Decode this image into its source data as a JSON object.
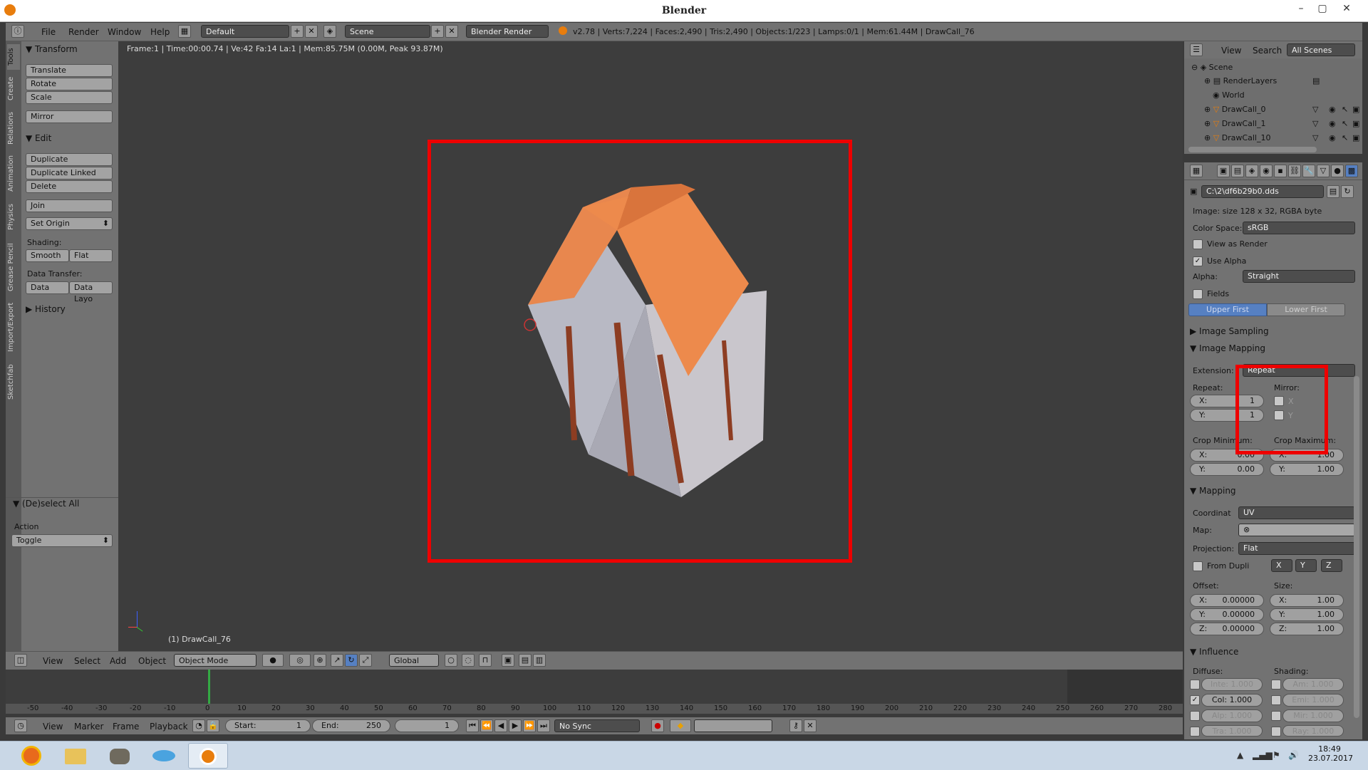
{
  "window": {
    "title": "Blender"
  },
  "infoheader": {
    "menus": [
      "File",
      "Render",
      "Window",
      "Help"
    ],
    "screen_layout": "Default",
    "scene": "Scene",
    "engine": "Blender Render",
    "stats": "v2.78 | Verts:7,224 | Faces:2,490 | Tris:2,490 | Objects:1/223 | Lamps:0/1 | Mem:61.44M | DrawCall_76"
  },
  "left_tabs": [
    "Tools",
    "Create",
    "Relations",
    "Animation",
    "Physics",
    "Grease Pencil",
    "Import/Export",
    "Sketchfab"
  ],
  "toolshelf": {
    "transform": {
      "title": "Transform",
      "buttons": [
        "Translate",
        "Rotate",
        "Scale",
        "Mirror"
      ]
    },
    "edit": {
      "title": "Edit",
      "buttons": [
        "Duplicate",
        "Duplicate Linked",
        "Delete",
        "Join"
      ],
      "set_origin": "Set Origin"
    },
    "shading_label": "Shading:",
    "shading": [
      "Smooth",
      "Flat"
    ],
    "data_transfer_label": "Data Transfer:",
    "data_transfer": [
      "Data",
      "Data Layo"
    ],
    "history": "History",
    "deselect": {
      "title": "(De)select All",
      "action_label": "Action",
      "action": "Toggle"
    }
  },
  "viewport": {
    "info": "Frame:1 | Time:00:00.74 | Ve:42 Fa:14 La:1 | Mem:85.75M (0.00M, Peak 93.87M)",
    "object_label": "(1) DrawCall_76"
  },
  "view3d_header": {
    "menus": [
      "View",
      "Select",
      "Add",
      "Object"
    ],
    "mode": "Object Mode",
    "orientation": "Global"
  },
  "timeline": {
    "ticks": [
      "-50",
      "-40",
      "-30",
      "-20",
      "-10",
      "0",
      "10",
      "20",
      "30",
      "40",
      "50",
      "60",
      "70",
      "80",
      "90",
      "100",
      "110",
      "120",
      "130",
      "140",
      "150",
      "160",
      "170",
      "180",
      "190",
      "200",
      "210",
      "220",
      "230",
      "240",
      "250",
      "260",
      "270",
      "280"
    ],
    "menus": [
      "View",
      "Marker",
      "Frame",
      "Playback"
    ],
    "start_label": "Start:",
    "start": "1",
    "end_label": "End:",
    "end": "250",
    "current": "1",
    "sync": "No Sync"
  },
  "outliner": {
    "menus": [
      "View",
      "Search"
    ],
    "filter": "All Scenes",
    "items": [
      "Scene",
      "RenderLayers",
      "World",
      "DrawCall_0",
      "DrawCall_1",
      "DrawCall_10"
    ]
  },
  "properties": {
    "image_path": "C:\\2\\df6b29b0.dds",
    "image_info": "Image: size 128 x 32, RGBA byte",
    "color_space_label": "Color Space:",
    "color_space": "sRGB",
    "view_as_render": "View as Render",
    "use_alpha": "Use Alpha",
    "alpha_label": "Alpha:",
    "alpha": "Straight",
    "fields": "Fields",
    "upper_first": "Upper First",
    "lower_first": "Lower First",
    "image_sampling": "Image Sampling",
    "image_mapping": "Image Mapping",
    "extension_label": "Extension:",
    "extension": "Repeat",
    "repeat_label": "Repeat:",
    "mirror_label": "Mirror:",
    "repeat_x_label": "X:",
    "repeat_x": "1",
    "repeat_y_label": "Y:",
    "repeat_y": "1",
    "mirror_x": "X",
    "mirror_y": "Y",
    "crop_min_label": "Crop Minimum:",
    "crop_max_label": "Crop Maximum:",
    "crop_min_x_label": "X:",
    "crop_min_x": "0.00",
    "crop_min_y_label": "Y:",
    "crop_min_y": "0.00",
    "crop_max_x_label": "X:",
    "crop_max_x": "1.00",
    "crop_max_y_label": "Y:",
    "crop_max_y": "1.00",
    "mapping": "Mapping",
    "coord_label": "Coordinat",
    "coord": "UV",
    "map_label": "Map:",
    "projection_label": "Projection:",
    "projection": "Flat",
    "from_dupli": "From Dupli",
    "axes": [
      "X",
      "Y",
      "Z"
    ],
    "offset_label": "Offset:",
    "size_label": "Size:",
    "offset_x_label": "X:",
    "offset_x": "0.00000",
    "offset_y_label": "Y:",
    "offset_y": "0.00000",
    "offset_z_label": "Z:",
    "offset_z": "0.00000",
    "size_x_label": "X:",
    "size_x": "1.00",
    "size_y_label": "Y:",
    "size_y": "1.00",
    "size_z_label": "Z:",
    "size_z": "1.00",
    "influence": "Influence",
    "diffuse_label": "Diffuse:",
    "shading_label": "Shading:",
    "inte": "Inte: 1.000",
    "col": "Col: 1.000",
    "alp": "Alp: 1.000",
    "tra": "Tra: 1.000",
    "am": "Am: 1.000",
    "emi": "Emi: 1.000",
    "mir": "Mir: 1.000",
    "ray": "Ray: 1.000"
  },
  "taskbar": {
    "time": "18:49",
    "date": "23.07.2017"
  },
  "colors": {
    "highlight": "#ee0000",
    "blender_orange": "#e87d0d",
    "selected_tab": "#5680c2"
  }
}
